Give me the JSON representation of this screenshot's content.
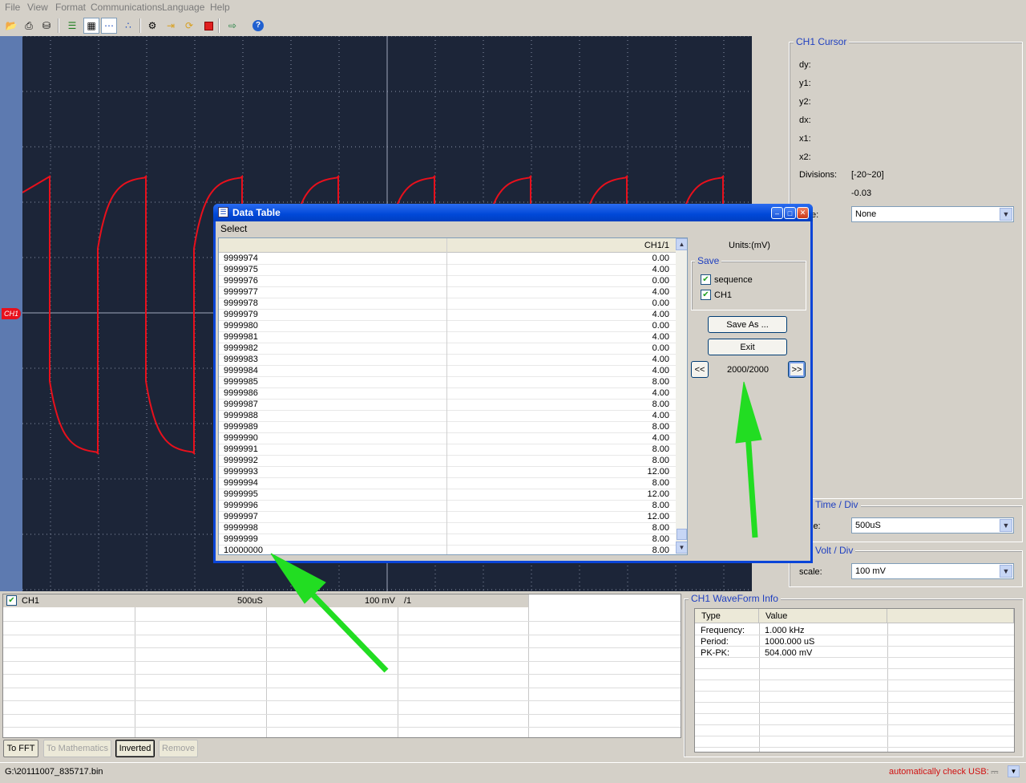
{
  "menu": [
    "File",
    "View",
    "Format",
    "Communications",
    "Language",
    "Help"
  ],
  "toolbar_icons": [
    "open-folder-icon",
    "print-icon",
    "print-preview-icon",
    "list-icon",
    "grid-icon",
    "dots-icon",
    "scatter-icon",
    "settings-icon",
    "import-icon",
    "refresh-icon",
    "stop-icon",
    "export-icon",
    "help-icon"
  ],
  "scope": {
    "channel_marker": "CH1",
    "trace_color": "#e8101c",
    "background": "#1c2538"
  },
  "cursor_panel": {
    "title": "CH1 Cursor",
    "labels": [
      "dy:",
      "y1:",
      "y2:",
      "dx:",
      "x1:",
      "x2:",
      "Divisions:"
    ],
    "divisions_value": "[-20~20]",
    "offset_value": "-0.03",
    "type_label": "e:",
    "type_value": "None"
  },
  "time_panel": {
    "title": "Time / Div",
    "label": "le:",
    "value": "500uS"
  },
  "volt_panel": {
    "title": "Volt / Div",
    "label": "scale:",
    "value": "100 mV"
  },
  "channel_grid": {
    "name": "CH1",
    "time": "500uS",
    "volt": "100 mV",
    "probe": "/1"
  },
  "bottom_buttons": {
    "fft": "To FFT",
    "math": "To Mathematics",
    "inverted": "Inverted",
    "remove": "Remove"
  },
  "waveform_info": {
    "title": "CH1 WaveForm Info",
    "headers": [
      "Type",
      "Value"
    ],
    "rows": [
      [
        "Frequency:",
        "1.000 kHz"
      ],
      [
        "Period:",
        "1000.000 uS"
      ],
      [
        "PK-PK:",
        "504.000 mV"
      ]
    ]
  },
  "status": {
    "path": "G:\\20111007_835717.bin",
    "usb": "automatically check USB:",
    "usb_color": "#d01010"
  },
  "dialog": {
    "title": "Data Table",
    "menu": "Select",
    "column_header": "CH1/1",
    "units": "Units:(mV)",
    "save_group": "Save",
    "save_sequence": "sequence",
    "save_ch1": "CH1",
    "save_as_button": "Save As ...",
    "exit_button": "Exit",
    "prev_button": "<<",
    "next_button": ">>",
    "page": "2000/2000",
    "rows": [
      [
        "9999974",
        "0.00"
      ],
      [
        "9999975",
        "4.00"
      ],
      [
        "9999976",
        "0.00"
      ],
      [
        "9999977",
        "4.00"
      ],
      [
        "9999978",
        "0.00"
      ],
      [
        "9999979",
        "4.00"
      ],
      [
        "9999980",
        "0.00"
      ],
      [
        "9999981",
        "4.00"
      ],
      [
        "9999982",
        "0.00"
      ],
      [
        "9999983",
        "4.00"
      ],
      [
        "9999984",
        "4.00"
      ],
      [
        "9999985",
        "8.00"
      ],
      [
        "9999986",
        "4.00"
      ],
      [
        "9999987",
        "8.00"
      ],
      [
        "9999988",
        "4.00"
      ],
      [
        "9999989",
        "8.00"
      ],
      [
        "9999990",
        "4.00"
      ],
      [
        "9999991",
        "8.00"
      ],
      [
        "9999992",
        "8.00"
      ],
      [
        "9999993",
        "12.00"
      ],
      [
        "9999994",
        "8.00"
      ],
      [
        "9999995",
        "12.00"
      ],
      [
        "9999996",
        "8.00"
      ],
      [
        "9999997",
        "12.00"
      ],
      [
        "9999998",
        "8.00"
      ],
      [
        "9999999",
        "8.00"
      ],
      [
        "10000000",
        "8.00"
      ]
    ]
  },
  "annotation_color": "#22dd22"
}
